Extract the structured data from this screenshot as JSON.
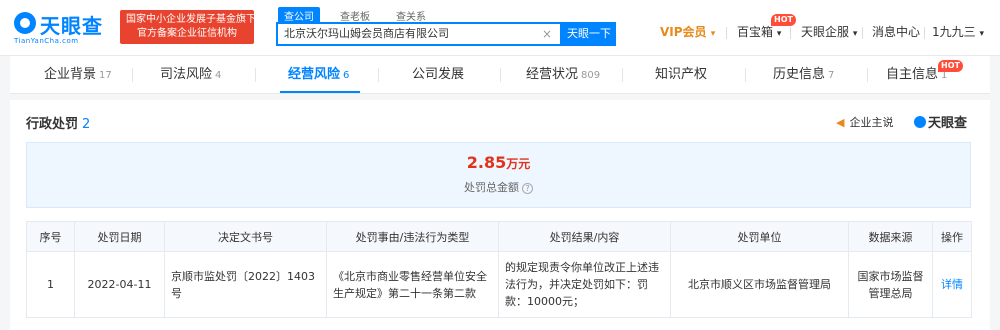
{
  "header": {
    "logo_text": "天眼查",
    "logo_sub": "TianYanCha.com",
    "gov_badge": [
      "国家中小企业发展子基金旗下",
      "官方备案企业征信机构"
    ],
    "search_tabs": [
      "查公司",
      "查老板",
      "查关系"
    ],
    "search_value": "北京沃尔玛山姆会员商店有限公司",
    "search_button": "天眼一下",
    "nav": {
      "vip": "VIP会员",
      "treasure": "百宝箱",
      "hot": "HOT",
      "enterprise": "天眼企服",
      "messages": "消息中心",
      "user": "1九九三"
    }
  },
  "tabs": [
    {
      "label": "企业背景",
      "count": "17"
    },
    {
      "label": "司法风险",
      "count": "4"
    },
    {
      "label": "经营风险",
      "count": "6",
      "active": true
    },
    {
      "label": "公司发展",
      "count": ""
    },
    {
      "label": "经营状况",
      "count": "809"
    },
    {
      "label": "知识产权",
      "count": ""
    },
    {
      "label": "历史信息",
      "count": "7"
    },
    {
      "label": "自主信息",
      "count": "1",
      "hot": "HOT"
    }
  ],
  "section": {
    "title": "行政处罚",
    "count": "2",
    "self_report": "企业主说",
    "brand": "天眼查"
  },
  "summary": {
    "amount": "2.85",
    "unit": "万元",
    "label": "处罚总金额"
  },
  "table": {
    "headers": [
      "序号",
      "处罚日期",
      "决定文书号",
      "处罚事由/违法行为类型",
      "处罚结果/内容",
      "处罚单位",
      "数据来源",
      "操作"
    ],
    "rows": [
      {
        "index": "1",
        "date": "2022-04-11",
        "doc_no": "京顺市监处罚〔2022〕1403号",
        "reason": "《北京市商业零售经营单位安全生产规定》第二十一条第二款",
        "result": "的规定现责令你单位改正上述违法行为，并决定处罚如下：罚款：10000元；",
        "unit": "北京市顺义区市场监督管理局",
        "source": "国家市场监督管理总局",
        "action": "详情"
      }
    ]
  },
  "colors": {
    "brand_blue": "#0084ff",
    "amount_red": "#e3321b",
    "vip_orange": "#e8891c",
    "hot_red": "#ff4d3a"
  }
}
